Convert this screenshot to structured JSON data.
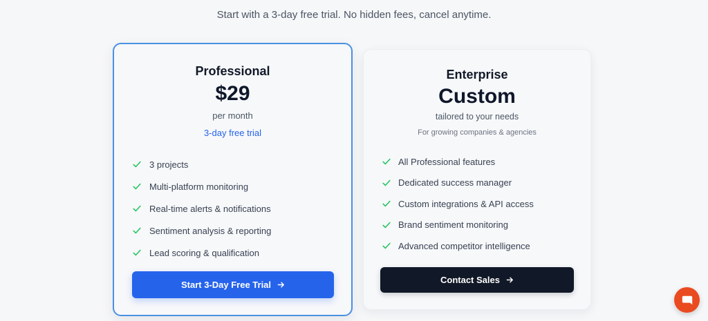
{
  "header": {
    "subtitle": "Start with a 3-day free trial. No hidden fees, cancel anytime."
  },
  "plans": [
    {
      "name": "Professional",
      "price": "$29",
      "period": "per month",
      "trial_note": "3-day free trial",
      "features": [
        "3 projects",
        "Multi-platform monitoring",
        "Real-time alerts & notifications",
        "Sentiment analysis & reporting",
        "Lead scoring & qualification"
      ],
      "cta_label": "Start 3-Day Free Trial",
      "highlighted": true
    },
    {
      "name": "Enterprise",
      "price": "Custom",
      "period": "tailored to your needs",
      "audience": "For growing companies & agencies",
      "features": [
        "All Professional features",
        "Dedicated success manager",
        "Custom integrations & API access",
        "Brand sentiment monitoring",
        "Advanced competitor intelligence"
      ],
      "cta_label": "Contact Sales",
      "highlighted": false
    }
  ],
  "chat_widget": {
    "icon": "chat-bubble-icon"
  },
  "colors": {
    "accent_blue": "#2563eb",
    "highlight_border": "#4a90e2",
    "dark_button": "#111827",
    "check_green": "#22c55e",
    "chat_orange": "#ea4a1f"
  }
}
